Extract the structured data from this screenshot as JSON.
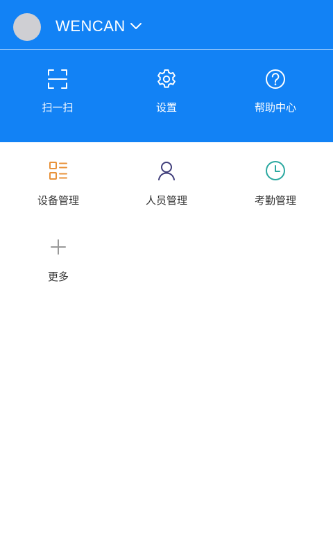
{
  "user": {
    "name": "WENCAN"
  },
  "quick_actions": [
    {
      "label": "扫一扫",
      "icon": "scan-icon"
    },
    {
      "label": "设置",
      "icon": "gear-icon"
    },
    {
      "label": "帮助中心",
      "icon": "help-icon"
    }
  ],
  "modules": [
    {
      "label": "设备管理",
      "icon": "device-list-icon",
      "color": "#e8923a"
    },
    {
      "label": "人员管理",
      "icon": "person-icon",
      "color": "#3f3d7a"
    },
    {
      "label": "考勤管理",
      "icon": "clock-icon",
      "color": "#2aa8a0"
    },
    {
      "label": "更多",
      "icon": "plus-icon",
      "color": "#999999"
    }
  ],
  "colors": {
    "header_bg": "#1282f5",
    "avatar": "#cfcfd3"
  }
}
